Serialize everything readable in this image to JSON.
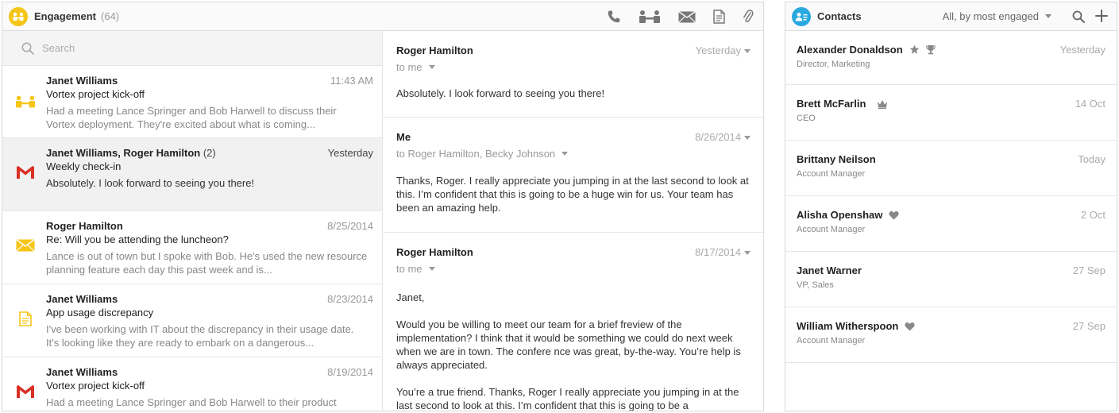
{
  "engagement": {
    "title": "Engagement",
    "count": "(64)",
    "toolbar_icons": [
      "phone-icon",
      "meeting-icon",
      "email-icon",
      "document-icon",
      "attachment-icon"
    ],
    "search_placeholder": "Search",
    "items": [
      {
        "sender": "Janet Williams",
        "sender_count": "",
        "date": "11:43 AM",
        "subject": "Vortex project kick-off",
        "snippet": "Had a meeting Lance Springer and Bob Harwell to discuss their Vortex deployment. They're excited about what is coming...",
        "icon": "meeting-icon"
      },
      {
        "sender": "Janet Williams, Roger Hamilton",
        "sender_count": "(2)",
        "date": "Yesterday",
        "subject": "Weekly check-in",
        "snippet": "Absolutely. I look forward to seeing you there!",
        "icon": "gmail-icon"
      },
      {
        "sender": "Roger Hamilton",
        "sender_count": "",
        "date": "8/25/2014",
        "subject": "Re: Will you be attending the luncheon?",
        "snippet": "Lance is out of town but I spoke with Bob. He's used the new resource planning feature each day this past week and is...",
        "icon": "envelope-icon"
      },
      {
        "sender": "Janet Williams",
        "sender_count": "",
        "date": "8/23/2014",
        "subject": "App usage discrepancy",
        "snippet": "I've been working with IT about the discrepancy in their usage date. It's looking like they are ready to embark on a dangerous...",
        "icon": "note-icon"
      },
      {
        "sender": "Janet Williams",
        "sender_count": "",
        "date": "8/19/2014",
        "subject": "Vortex project kick-off",
        "snippet": "Had a meeting Lance Springer and Bob Harwell to their product",
        "icon": "gmail-icon"
      }
    ],
    "thread": [
      {
        "from": "Roger Hamilton",
        "date": "Yesterday",
        "to": "to me",
        "body": [
          "Absolutely. I look forward to seeing you there!"
        ]
      },
      {
        "from": "Me",
        "date": "8/26/2014",
        "to": "to Roger Hamilton, Becky Johnson",
        "body": [
          "Thanks, Roger. I really appreciate you jumping in at the last second to look at this. I’m confident that this is going to be a huge win for us. Your team has been an amazing help."
        ]
      },
      {
        "from": "Roger Hamilton",
        "date": "8/17/2014",
        "to": "to me",
        "body": [
          "Janet,",
          "Would you be willing to meet our team for a brief freview of the implementation? I think that it would be something we could do next week when we are in town. The confere nce was great, by-the-way. You’re help is always appreciated.",
          "You’re a true friend. Thanks, Roger I really appreciate you jumping in at the last second to look at this. I’m confident that this is going to be a"
        ]
      }
    ]
  },
  "contacts": {
    "title": "Contacts",
    "filter": "All, by most engaged",
    "items": [
      {
        "name": "Alexander Donaldson",
        "role": "Director, Marketing",
        "date": "Yesterday",
        "icons": [
          "star-icon",
          "trophy-icon"
        ]
      },
      {
        "name": "Brett McFarlin",
        "role": "CEO",
        "date": "14 Oct",
        "icons": [
          "crown-icon"
        ]
      },
      {
        "name": "Brittany Neilson",
        "role": "Account Manager",
        "date": "Today",
        "icons": []
      },
      {
        "name": "Alisha Openshaw",
        "role": "Account Manager",
        "date": "2 Oct",
        "icons": [
          "heart-icon"
        ]
      },
      {
        "name": "Janet Warner",
        "role": "VP, Sales",
        "date": "27 Sep",
        "icons": []
      },
      {
        "name": "William Witherspoon",
        "role": "Account Manager",
        "date": "27 Sep",
        "icons": [
          "heart-icon"
        ]
      }
    ]
  },
  "colors": {
    "accent_yellow": "#f5c518",
    "accent_blue": "#2aa8e0",
    "gmail_red": "#d93025"
  }
}
